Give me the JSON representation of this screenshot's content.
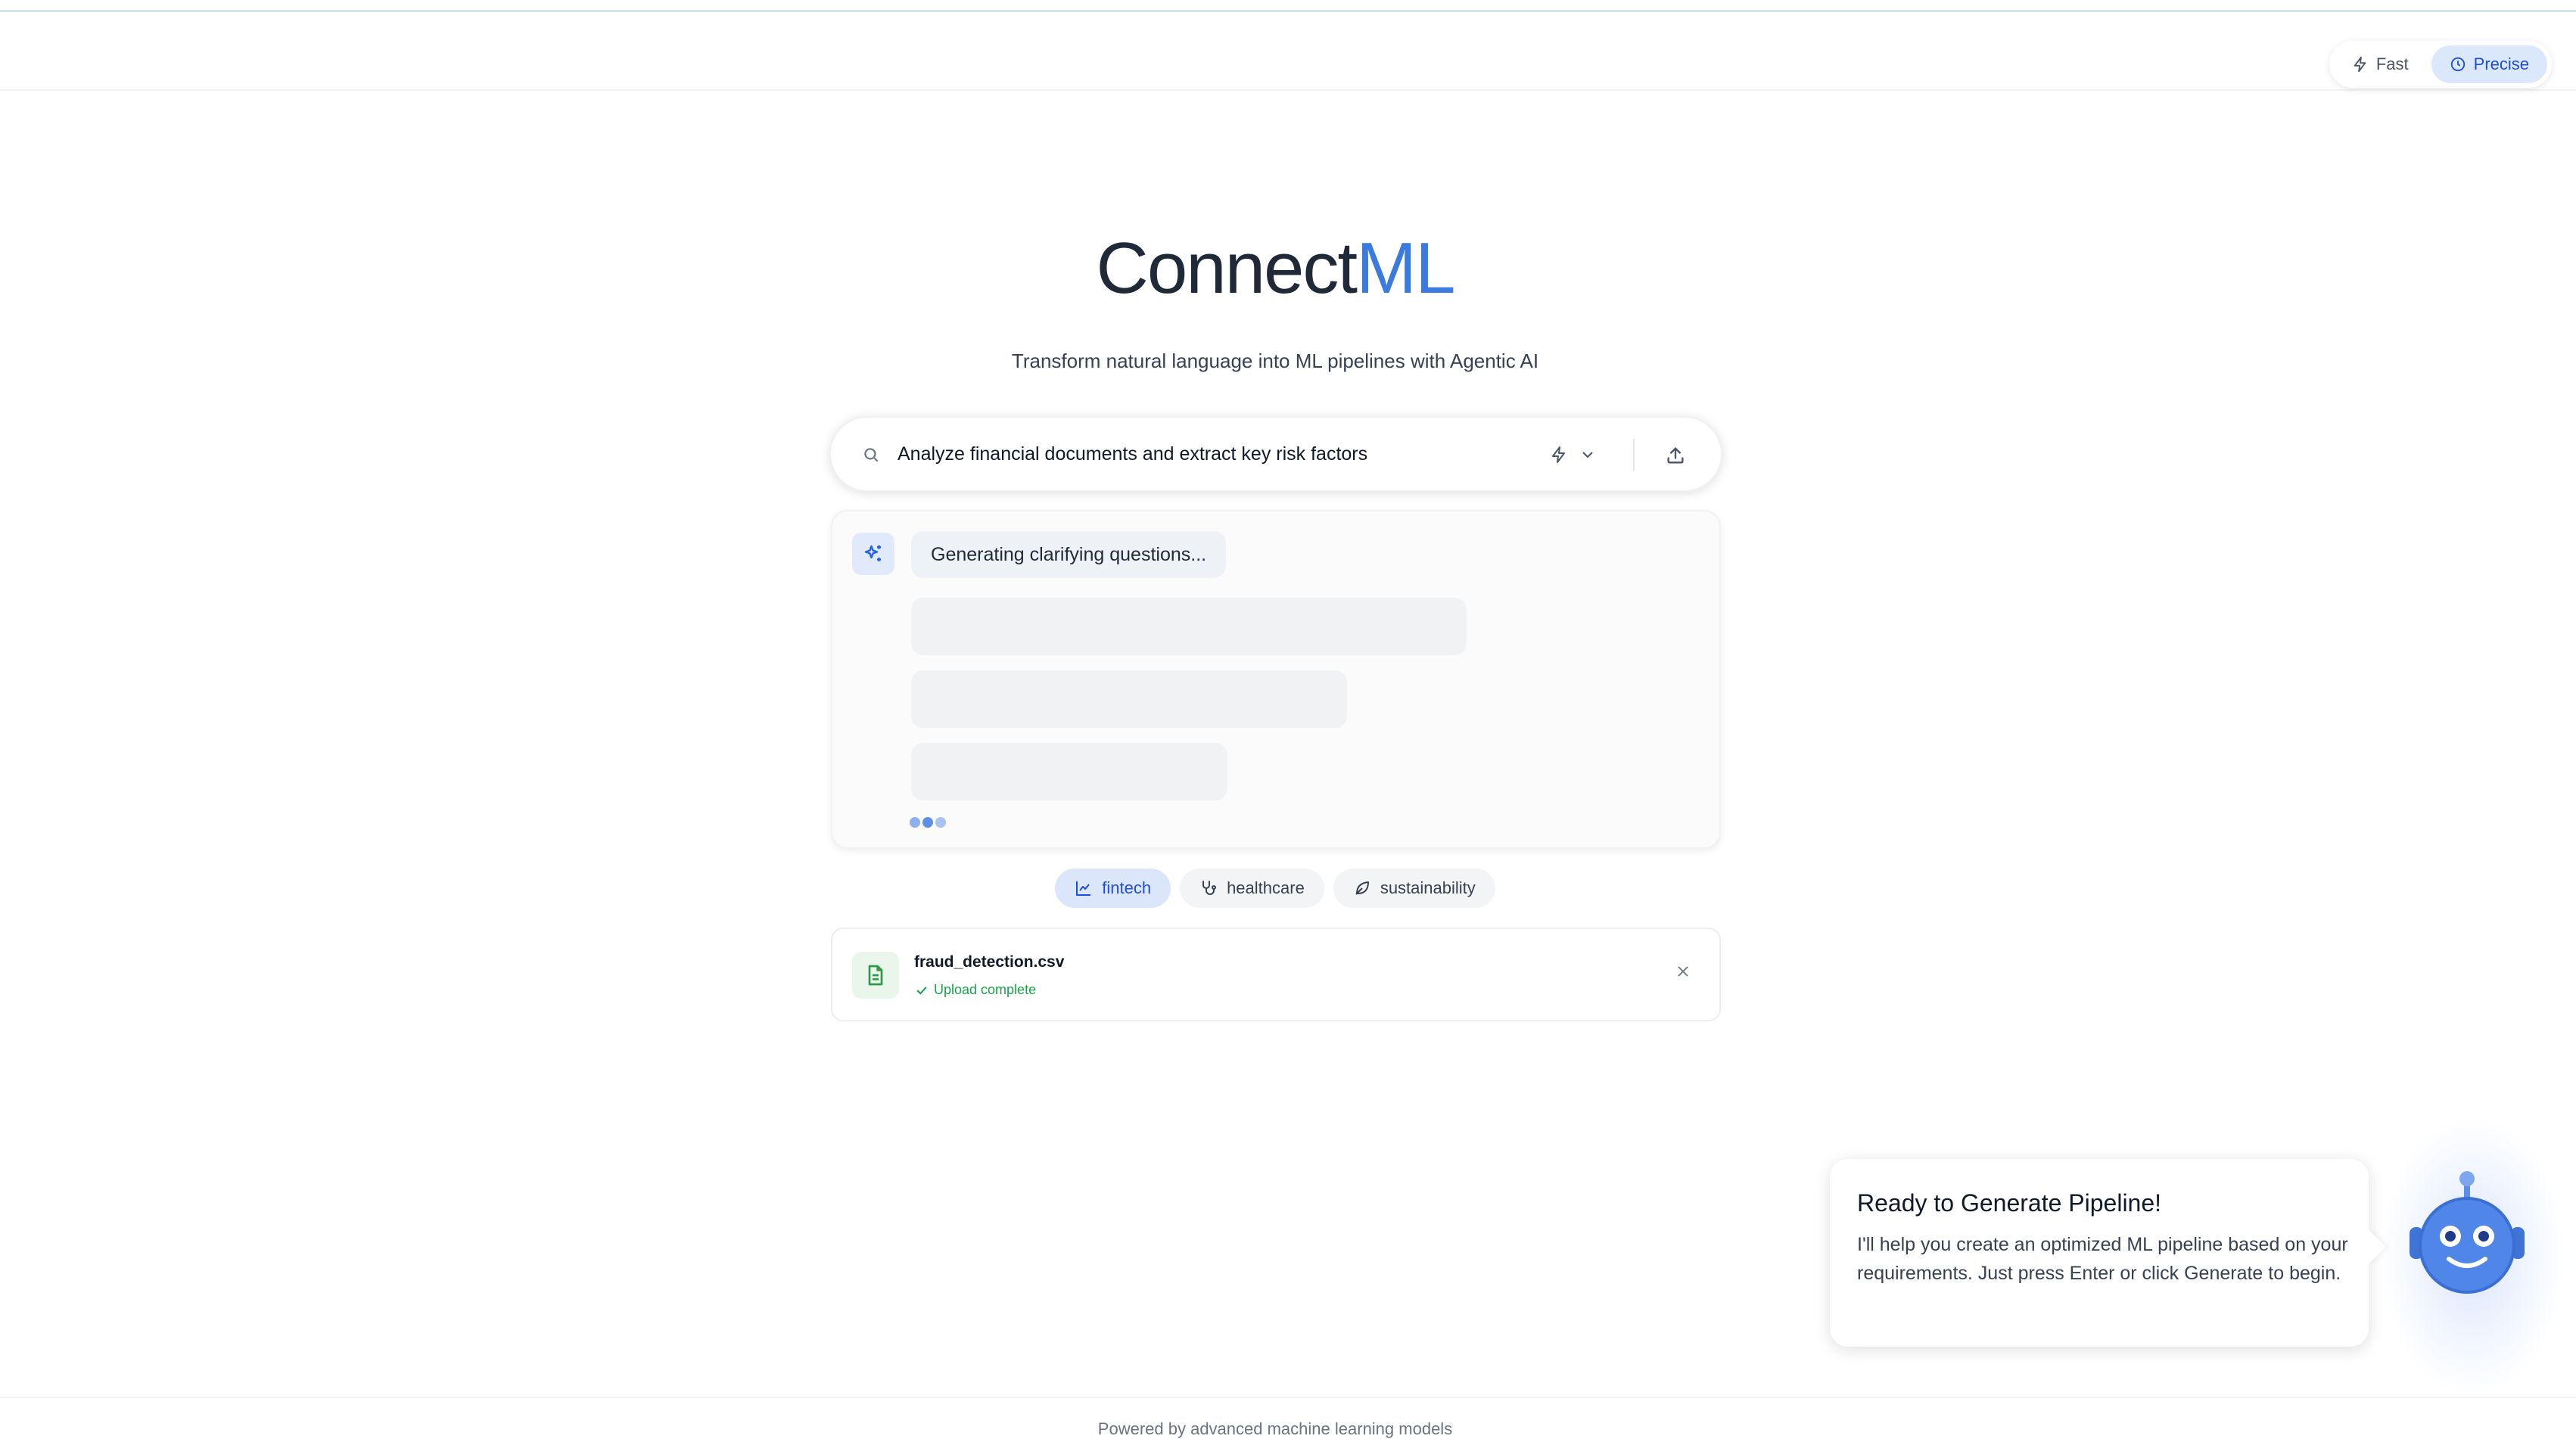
{
  "header": {
    "mode_toggle": {
      "fast_label": "Fast",
      "precise_label": "Precise",
      "selected": "Precise"
    }
  },
  "hero": {
    "logo_primary": "Connect",
    "logo_accent": "ML",
    "subtitle": "Transform natural language into ML pipelines with Agentic AI"
  },
  "search": {
    "value": "Analyze financial documents and extract key risk factors",
    "model_icon": "bolt-icon",
    "upload_icon": "upload-icon"
  },
  "questions_panel": {
    "status": "Generating clarifying questions..."
  },
  "tags": {
    "items": [
      {
        "label": "fintech",
        "icon": "chart-line-icon",
        "active": true
      },
      {
        "label": "healthcare",
        "icon": "stethoscope-icon",
        "active": false
      },
      {
        "label": "sustainability",
        "icon": "leaf-icon",
        "active": false
      }
    ]
  },
  "file": {
    "name": "fraud_detection.csv",
    "status": "Upload complete"
  },
  "assistant": {
    "title": "Ready to Generate Pipeline!",
    "message": "I'll help you create an optimized ML pipeline based on your requirements. Just press Enter or click Generate to begin."
  },
  "footer": {
    "text": "Powered by advanced machine learning models"
  },
  "colors": {
    "accent": "#3b7be0",
    "active_tag_bg": "#dbe6fb",
    "success": "#16a34a",
    "robot": "#4f86e8"
  }
}
